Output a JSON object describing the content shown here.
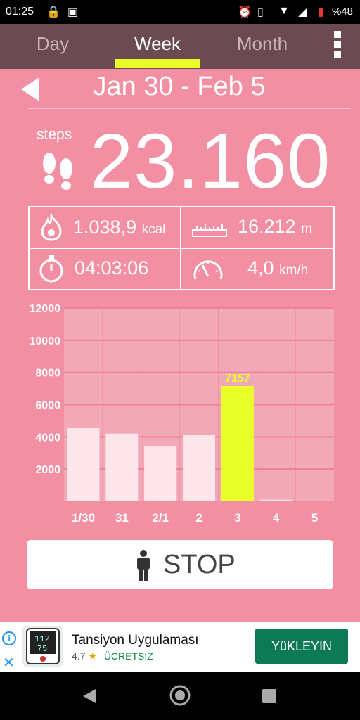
{
  "status_bar": {
    "time": "01:25",
    "battery": "%48"
  },
  "tabs": [
    {
      "label": "Day",
      "active": false
    },
    {
      "label": "Week",
      "active": true
    },
    {
      "label": "Month",
      "active": false
    }
  ],
  "header": {
    "date_range": "Jan 30 - Feb 5"
  },
  "steps": {
    "label": "steps",
    "value": "23.160"
  },
  "stats": {
    "calories": {
      "value": "1.038,9",
      "unit": "kcal"
    },
    "distance": {
      "value": "16.212",
      "unit": "m"
    },
    "duration": {
      "value": "04:03:06"
    },
    "speed": {
      "value": "4,0",
      "unit": "km/h"
    }
  },
  "chart_data": {
    "type": "bar",
    "categories": [
      "1/30",
      "31",
      "2/1",
      "2",
      "3",
      "4",
      "5"
    ],
    "values": [
      4550,
      4200,
      3400,
      4100,
      7157,
      100,
      0
    ],
    "ylim": [
      0,
      12000
    ],
    "yticks": [
      "2000",
      "4000",
      "6000",
      "8000",
      "10000",
      "12000"
    ],
    "highlight_index": 4,
    "highlight_label": "7157",
    "colors": {
      "bar": "#fde6ea",
      "highlight": "#e8ff29",
      "plot_bg": "#f2a9b7",
      "grid": "#f17f96"
    }
  },
  "stop_button": {
    "label": "STOP"
  },
  "ad": {
    "title": "Tansiyon Uygulaması",
    "rating": "4.7",
    "price": "ÜCRETSIZ",
    "cta": "YüKLEYIN",
    "close": "✕",
    "info": "i",
    "thumb_text": {
      "top": "112",
      "bottom": "75"
    }
  }
}
